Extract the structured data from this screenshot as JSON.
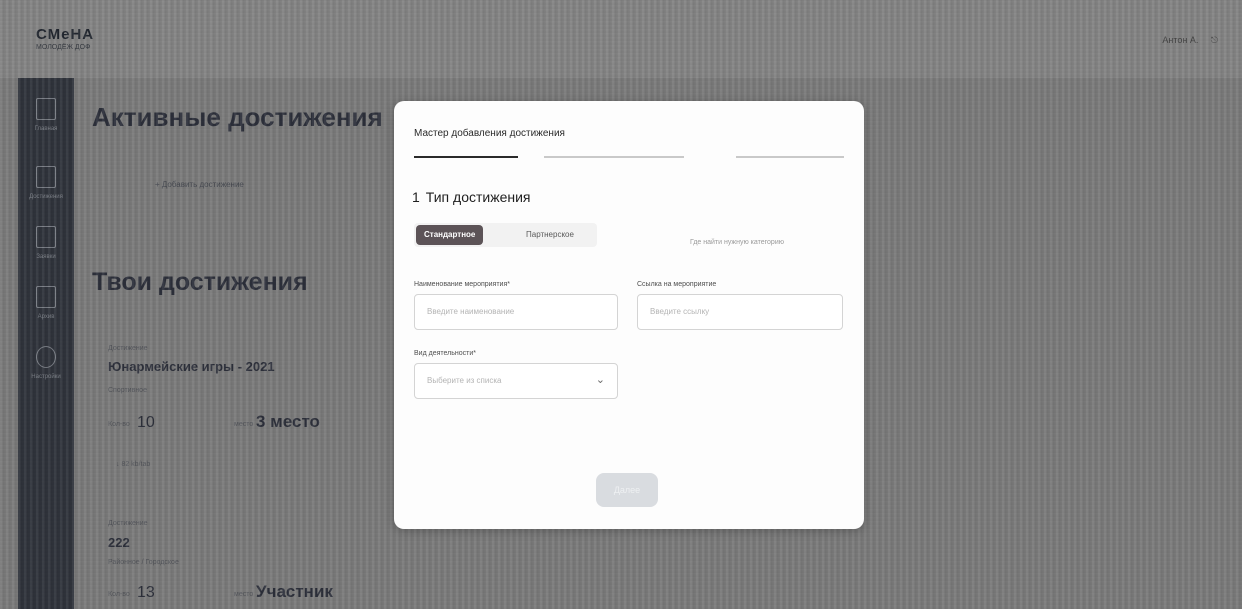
{
  "header": {
    "logo_name": "СМеНА",
    "logo_sub": "МОЛОДЁЖ ДОФ",
    "user": "Антон А.",
    "exit_glyph": "⎋"
  },
  "sidebar": {
    "items": [
      {
        "label": "Главная",
        "icon": "home-icon"
      },
      {
        "label": "Достижения",
        "icon": "trophy-icon"
      },
      {
        "label": "Заявки",
        "icon": "clipboard-icon"
      },
      {
        "label": "Архив",
        "icon": "archive-icon"
      },
      {
        "label": "Настройки",
        "icon": "settings-icon"
      }
    ]
  },
  "page": {
    "active_title": "Активные достижения",
    "add_link": "+ Добавить достижение",
    "yours_title": "Твои достижения",
    "items": [
      {
        "meta": "Достижение",
        "name": "Юнармейские игры - 2021",
        "type": "Спортивное",
        "count_label": "Кол-во",
        "count": "10",
        "place_label": "место",
        "place": "3 место",
        "file": "↓ 82 kb/tab"
      },
      {
        "meta": "Достижение",
        "name": "222",
        "type": "Районное / Городское",
        "count_label": "Кол-во",
        "count": "13",
        "place_label": "место",
        "place": "Участник"
      }
    ]
  },
  "modal": {
    "title": "Мастер добавления достижения",
    "step_number": "1",
    "step_title": "Тип достижения",
    "toggle": {
      "selected": "Стандартное",
      "other": "Партнерское"
    },
    "hint": "Где найти нужную категорию",
    "fields": {
      "event_name_label": "Наименование мероприятия*",
      "event_name_placeholder": "Введите наименование",
      "event_link_label": "Ссылка на мероприятие",
      "event_link_placeholder": "Введите ссылку",
      "activity_label": "Вид деятельности*",
      "activity_placeholder": "Выберите из списка"
    },
    "next_label": "Далее"
  },
  "colors": {
    "sidebar": "#323741",
    "toggle_active": "#5c5357",
    "modal_bg": "#fdfdfd",
    "next_button": "#d9dce0"
  }
}
